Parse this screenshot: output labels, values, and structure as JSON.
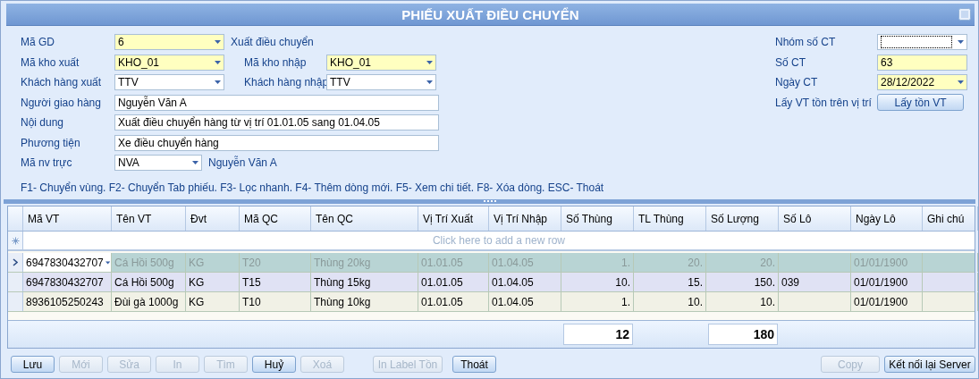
{
  "window": {
    "title": "PHIẾU XUẤT ĐIỀU CHUYỂN"
  },
  "form_rows": [
    {
      "fields": [
        {
          "label": "Mã GD",
          "value": "6",
          "kind": "combo",
          "required": true
        }
      ],
      "note": "Xuất điều chuyển"
    },
    {
      "fields": [
        {
          "label": "Mã kho xuất",
          "value": "KHO_01",
          "kind": "combo",
          "required": true
        },
        {
          "label": "Mã kho nhập",
          "value": "KHO_01",
          "kind": "combo",
          "required": true
        }
      ]
    },
    {
      "fields": [
        {
          "label": "Khách hàng xuất",
          "value": "TTV",
          "kind": "combo",
          "required": false
        },
        {
          "label": "Khách hàng nhập",
          "value": "TTV",
          "kind": "combo",
          "required": false
        }
      ]
    },
    {
      "fields": [
        {
          "label": "Người giao hàng",
          "value": "Nguyễn Văn A",
          "kind": "text",
          "required": false
        }
      ]
    },
    {
      "fields": [
        {
          "label": "Nội dung",
          "value": "Xuất điều chuyển hàng từ vị trí 01.01.05 sang 01.04.05",
          "kind": "text",
          "required": false
        }
      ]
    },
    {
      "fields": [
        {
          "label": "Phương tiện",
          "value": "Xe điều chuyển hàng",
          "kind": "text",
          "required": false
        }
      ]
    },
    {
      "fields": [
        {
          "label": "Mã nv trực",
          "value": "NVA",
          "kind": "lookup",
          "required": false
        }
      ],
      "note": "Nguyễn Văn A"
    }
  ],
  "hint": "F1- Chuyển vùng. F2- Chuyển Tab phiếu. F3- Lọc nhanh. F4- Thêm dòng mới. F5- Xem chi tiết. F8- Xóa dòng. ESC- Thoát",
  "voucher_fields": [
    {
      "label": "Nhóm số CT",
      "kind": "combo",
      "required": false,
      "focused": true
    },
    {
      "label": "Số CT",
      "value": "63",
      "kind": "text",
      "required": true,
      "focused": false
    },
    {
      "label": "Ngày CT",
      "value": "28/12/2022",
      "kind": "combo",
      "required": true,
      "focused": false
    }
  ],
  "stock_lookup": {
    "label": "Lấy VT tồn trên vị trí",
    "button": "Lấy tồn VT"
  },
  "table": {
    "columns": [
      {
        "label": "Mã VT",
        "kind": "text"
      },
      {
        "label": "Tên VT",
        "kind": "text"
      },
      {
        "label": "Đvt",
        "kind": "text"
      },
      {
        "label": "Mã QC",
        "kind": "text"
      },
      {
        "label": "Tên QC",
        "kind": "text"
      },
      {
        "label": "Vị Trí Xuất",
        "kind": "text"
      },
      {
        "label": "Vị Trí Nhập",
        "kind": "text"
      },
      {
        "label": "Số Thùng",
        "kind": "number",
        "total": "12"
      },
      {
        "label": "TL Thùng",
        "kind": "number"
      },
      {
        "label": "Số Lượng",
        "kind": "number",
        "total": "180"
      },
      {
        "label": "Số Lô",
        "kind": "text"
      },
      {
        "label": "Ngày Lô",
        "kind": "text"
      },
      {
        "label": "Ghi chú",
        "kind": "text"
      }
    ],
    "new_row_hint": "Click here to add a new row",
    "rows": [
      {
        "selected": true,
        "cells": [
          "6947830432707",
          "Cá Hồi 500g",
          "KG",
          "T20",
          "Thùng 20kg",
          "01.01.05",
          "01.04.05",
          "1.",
          "20.",
          "20.",
          "",
          "01/01/1900",
          ""
        ]
      },
      {
        "selected": false,
        "cells": [
          "6947830432707",
          "Cá Hồi 500g",
          "KG",
          "T15",
          "Thùng 15kg",
          "01.01.05",
          "01.04.05",
          "10.",
          "15.",
          "150.",
          "039",
          "01/01/1900",
          ""
        ]
      },
      {
        "selected": false,
        "cells": [
          "8936105250243",
          "Đùi gà 1000g",
          "KG",
          "T10",
          "Thùng 10kg",
          "01.01.05",
          "01.04.05",
          "1.",
          "10.",
          "10.",
          "",
          "01/01/1900",
          ""
        ]
      }
    ]
  },
  "actions": [
    {
      "label": "Lưu",
      "disabled": false
    },
    {
      "label": "Mới",
      "disabled": true
    },
    {
      "label": "Sửa",
      "disabled": true
    },
    {
      "label": "In",
      "disabled": true
    },
    {
      "label": "Tìm",
      "disabled": true
    },
    {
      "label": "Huỷ",
      "disabled": false
    },
    {
      "label": "Xoá",
      "disabled": true
    }
  ],
  "extra_actions": [
    {
      "label": "In Label Tồn",
      "disabled": true
    },
    {
      "label": "Thoát",
      "disabled": false
    }
  ],
  "server_actions": [
    {
      "label": "Copy",
      "disabled": true
    },
    {
      "label": "Kết nối lại Server",
      "disabled": false
    }
  ]
}
